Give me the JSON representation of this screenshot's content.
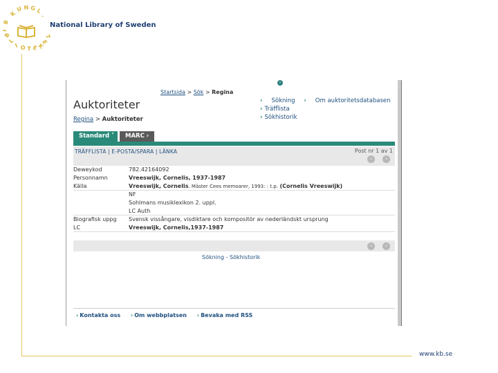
{
  "slide": {
    "logo_name": "National Library of Sweden",
    "logo_ring_text": "KUNGL BIBLIOTEKET",
    "website": "www.kb.se"
  },
  "screenshot": {
    "breadcrumb": {
      "home": "Startsida",
      "sep1": ">",
      "search": "Sök",
      "sep2": ">",
      "current": "Regina"
    },
    "page_title": "Auktoriteter",
    "right_links": {
      "search": "Sökning",
      "about": "Om auktoritetsdatabasen",
      "hitlist": "Träfflista",
      "history": "Sökhistorik"
    },
    "sub_breadcrumb": {
      "regina": "Regina",
      "sep": ">",
      "current": "Auktoriteter"
    },
    "tabs": {
      "standard": "Standard",
      "marc": "MARC"
    },
    "toolbar": {
      "links": "TRÄFFLISTA | E-POSTA/SPARA | LÄNKA",
      "post": "Post nr 1 av 1"
    },
    "record": [
      {
        "label": "Deweykod",
        "value": "782.42164092"
      },
      {
        "label": "Personnamn",
        "value": "Vreeswijk, Cornelis, 1937-1987"
      },
      {
        "label": "Källa",
        "value_bold": "Vreeswijk, Cornelis",
        "value_rest": ". Mäster Cees memoarer, 1993: : t.p.",
        "value_end": "(Cornelis Vreeswijk)"
      },
      {
        "label": "",
        "value": "NF"
      },
      {
        "label": "",
        "value": "Sohlmans musiklexikon 2. uppl."
      },
      {
        "label": "",
        "value": "LC Auth"
      },
      {
        "label": "Biografisk uppg",
        "value": "Svensk vissångare, visdiktare och kompositör av nederländskt ursprung"
      },
      {
        "label": "LC",
        "value": "Vreeswijk, Cornelis,1937-1987"
      }
    ],
    "bottom_links": {
      "search": "Sökning",
      "sep": "-",
      "history": "Sökhistorik"
    },
    "footer": {
      "contact": "Kontakta oss",
      "about": "Om webbplatsen",
      "rss": "Bevaka med RSS"
    }
  }
}
